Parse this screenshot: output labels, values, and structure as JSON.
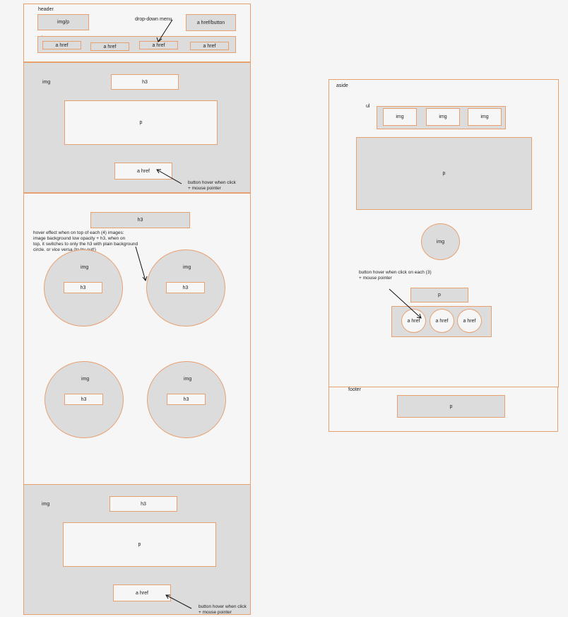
{
  "header": {
    "label": "header",
    "logo": "img/p",
    "dropdown_note": "drop-down menu",
    "action": "a href/button",
    "nav_label": "ul",
    "nav_links": [
      "a href",
      "a href",
      "a href",
      "a href"
    ]
  },
  "hero": {
    "img_label": "img",
    "heading": "h3",
    "paragraph": "p",
    "link": "a href",
    "note": "button hover when click\n+ mouse pointer"
  },
  "gallery": {
    "heading": "h3",
    "note": "hover effect when  on top of each (4) images:\nimage background low opacity + h3, when on\ntop, it switches to only the h3 with plain background\ncircle. or vice versa (to try out!)",
    "items": [
      {
        "img": "img",
        "heading": "h3"
      },
      {
        "img": "img",
        "heading": "h3"
      },
      {
        "img": "img",
        "heading": "h3"
      },
      {
        "img": "img",
        "heading": "h3"
      }
    ]
  },
  "bottom": {
    "img_label": "img",
    "heading": "h3",
    "paragraph": "p",
    "link": "a href",
    "note": "button hover when click\n+ mouse pointer"
  },
  "aside": {
    "label": "aside",
    "ul_label": "ul",
    "images": [
      "img",
      "img",
      "img"
    ],
    "paragraph": "p",
    "circle_img": "img",
    "note": "button hover when click on each (3)\n+ mouse pointer",
    "small_p": "p",
    "links": [
      "a href",
      "a href",
      "a href"
    ]
  },
  "footer": {
    "label": "footer",
    "paragraph": "p"
  },
  "colors": {
    "border": "#e8a070",
    "fill": "#dcdcdc",
    "canvas": "#f5f5f5"
  }
}
